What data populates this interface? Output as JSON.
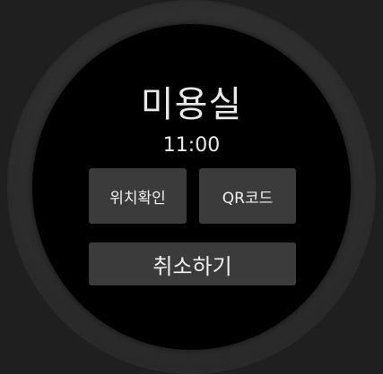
{
  "screen": {
    "title": "미용실",
    "time": "11:00"
  },
  "actions": {
    "location_label": "위치확인",
    "qr_label": "QR코드",
    "cancel_label": "취소하기"
  }
}
